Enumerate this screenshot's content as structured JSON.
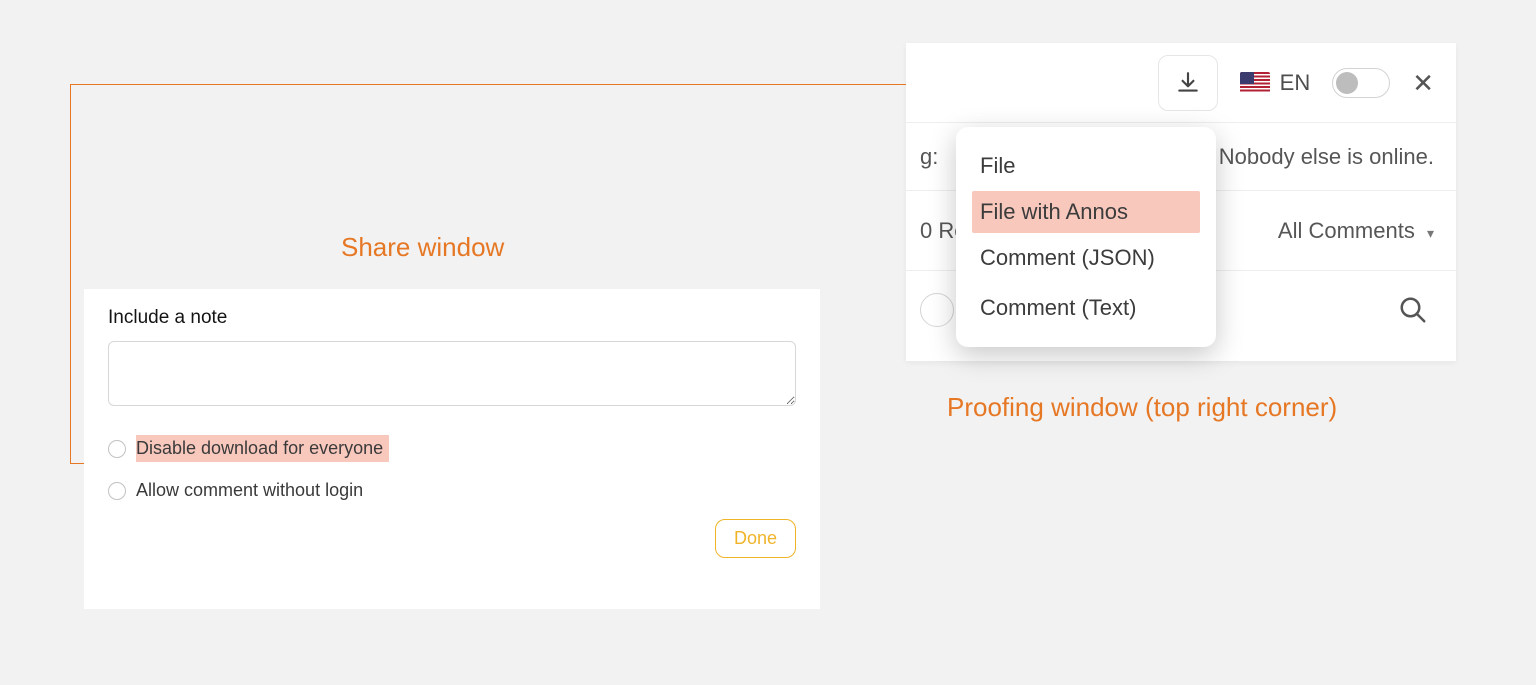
{
  "labels": {
    "share": "Share window",
    "proofing": "Proofing window (top right corner)"
  },
  "share": {
    "note_label": "Include a note",
    "disable_download": "Disable download for everyone",
    "allow_comment": "Allow comment without login",
    "done": "Done"
  },
  "proof": {
    "lang": "EN",
    "status_left": "g:",
    "status_right": "Nobody else is online.",
    "comments_left": "0 Re",
    "comments_right": "All Comments"
  },
  "menu": {
    "file": "File",
    "file_annos": "File with Annos",
    "comment_json": "Comment (JSON)",
    "comment_text": "Comment (Text)"
  },
  "colors": {
    "accent": "#e67825",
    "highlight": "#f8c8bd",
    "done_border": "#f0b429"
  }
}
